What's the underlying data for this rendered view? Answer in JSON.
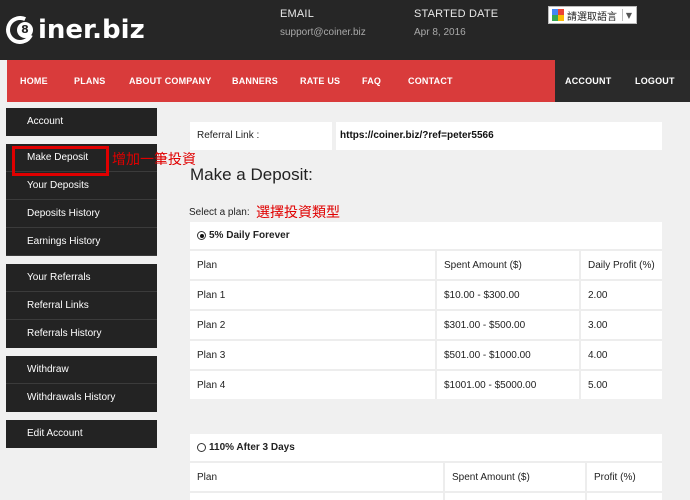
{
  "header": {
    "logo_glyph": "8",
    "logo_text": "iner.biz",
    "email_label": "EMAIL",
    "email_value": "support@coiner.biz",
    "started_label": "STARTED DATE",
    "started_value": "Apr 8, 2016",
    "translate_label": "請選取語言"
  },
  "nav": {
    "items": [
      "HOME",
      "PLANS",
      "ABOUT COMPANY",
      "BANNERS",
      "RATE US",
      "FAQ",
      "CONTACT"
    ],
    "right_items": [
      "ACCOUNT",
      "LOGOUT"
    ]
  },
  "sidebar": {
    "groups": [
      [
        "Account"
      ],
      [
        "Make Deposit",
        "Your Deposits",
        "Deposits History",
        "Earnings History"
      ],
      [
        "Your Referrals",
        "Referral Links",
        "Referrals History"
      ],
      [
        "Withdraw",
        "Withdrawals History"
      ],
      [
        "Edit Account"
      ]
    ]
  },
  "annotations": {
    "make_deposit_note": "增加一筆投資",
    "select_plan_note": "選擇投資類型"
  },
  "referral": {
    "label": "Referral Link :",
    "value": "https://coiner.biz/?ref=peter5566"
  },
  "main": {
    "title": "Make a Deposit:",
    "select_label": "Select a plan:"
  },
  "plans": [
    {
      "name": "5% Daily Forever",
      "selected": true,
      "headers": [
        "Plan",
        "Spent Amount ($)",
        "Daily Profit (%)"
      ],
      "rows": [
        [
          "Plan 1",
          "$10.00 - $300.00",
          "2.00"
        ],
        [
          "Plan 2",
          "$301.00 - $500.00",
          "3.00"
        ],
        [
          "Plan 3",
          "$501.00 - $1000.00",
          "4.00"
        ],
        [
          "Plan 4",
          "$1001.00 - $5000.00",
          "5.00"
        ]
      ]
    },
    {
      "name": "110% After 3 Days",
      "selected": false,
      "headers": [
        "Plan",
        "Spent Amount ($)",
        "Profit (%)"
      ],
      "rows": []
    }
  ],
  "colors": {
    "nav_red": "#d93b3b",
    "dark": "#232323",
    "annotation_red": "#e00000"
  }
}
